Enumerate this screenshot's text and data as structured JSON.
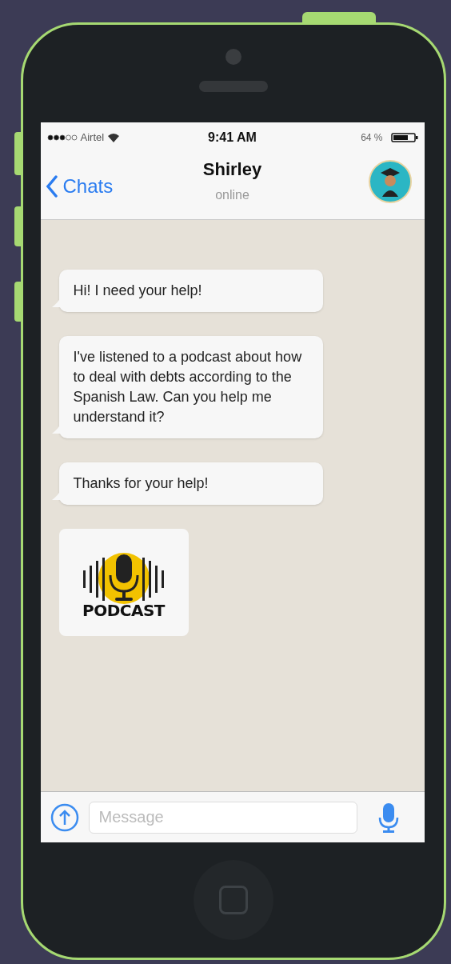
{
  "status_bar": {
    "carrier": "Airtel",
    "time": "9:41 AM",
    "battery": "64 %"
  },
  "header": {
    "back": "Chats",
    "name": "Shirley",
    "status": "online"
  },
  "messages": [
    {
      "kind": "text",
      "text": "Hi! I need your help!"
    },
    {
      "kind": "text",
      "text": "I've listened to a podcast about how to deal with debts according to the Spanish Law. Can you help me understand it?"
    },
    {
      "kind": "text",
      "text": "Thanks for your help!"
    },
    {
      "kind": "podcast",
      "text": "PODCAST"
    }
  ],
  "composer": {
    "placeholder": "Message"
  }
}
